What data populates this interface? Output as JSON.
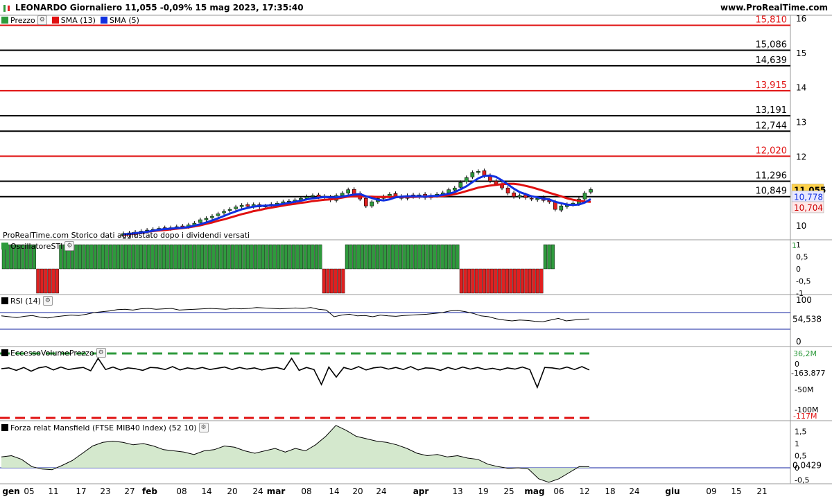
{
  "header": {
    "title": "LEONARDO Giornaliero 11,055 -0,09% 15 mag 2023, 17:35:40",
    "site": "www.ProRealTime.com"
  },
  "legend": {
    "price": "Prezzo",
    "sma13": "SMA (13)",
    "sma5": "SMA (5)"
  },
  "watermark": "ProRealTime.com  Storico dati aggiustato dopo i dividendi versati",
  "colors": {
    "up": "#2e9a3c",
    "down": "#e02020",
    "sma13": "#e01010",
    "sma5": "#1030e0",
    "hline_red": "#e01010",
    "hline_black": "#000000"
  },
  "chart_data": [
    {
      "type": "candlestick",
      "title": "LEONARDO Giornaliero",
      "ylim": [
        9.6,
        16.1
      ],
      "y_ticks": [
        "16",
        "15",
        "14",
        "13",
        "12",
        "10"
      ],
      "x_ticks": [
        "gen",
        "05",
        "11",
        "17",
        "23",
        "27",
        "feb",
        "08",
        "14",
        "20",
        "24",
        "mar",
        "08",
        "14",
        "20",
        "24",
        "apr",
        "13",
        "19",
        "25",
        "mag",
        "06",
        "12",
        "18",
        "24",
        "giu",
        "09",
        "15",
        "21"
      ],
      "horizontal_lines": [
        {
          "value": 15.81,
          "label": "15,810",
          "color": "red"
        },
        {
          "value": 15.086,
          "label": "15,086",
          "color": "black"
        },
        {
          "value": 14.639,
          "label": "14,639",
          "color": "black"
        },
        {
          "value": 13.915,
          "label": "13,915",
          "color": "red"
        },
        {
          "value": 13.191,
          "label": "13,191",
          "color": "black"
        },
        {
          "value": 12.744,
          "label": "12,744",
          "color": "black"
        },
        {
          "value": 12.02,
          "label": "12,020",
          "color": "red"
        },
        {
          "value": 11.296,
          "label": "11,296",
          "color": "black"
        },
        {
          "value": 10.849,
          "label": "10,849",
          "color": "black"
        }
      ],
      "price_tags": [
        {
          "label": "11,055",
          "value": 11.055,
          "bg": "#ffd24a"
        },
        {
          "label": "10,778",
          "value": 10.778,
          "bg": "#e8e8ff"
        },
        {
          "label": "10,704",
          "value": 10.704,
          "bg": "#ffe8e8"
        }
      ],
      "close": [
        9.78,
        9.74,
        9.82,
        9.85,
        9.88,
        9.9,
        9.93,
        9.92,
        9.95,
        9.98,
        9.97,
        10.03,
        10.08,
        10.18,
        10.22,
        10.28,
        10.35,
        10.42,
        10.48,
        10.55,
        10.6,
        10.57,
        10.62,
        10.55,
        10.58,
        10.63,
        10.66,
        10.7,
        10.72,
        10.75,
        10.8,
        10.85,
        10.88,
        10.84,
        10.82,
        10.75,
        10.88,
        10.95,
        11.05,
        10.92,
        10.78,
        10.58,
        10.7,
        10.8,
        10.85,
        10.92,
        10.86,
        10.8,
        10.88,
        10.85,
        10.9,
        10.82,
        10.88,
        10.92,
        10.96,
        11.05,
        11.1,
        11.26,
        11.4,
        11.55,
        11.58,
        11.45,
        11.3,
        11.22,
        11.1,
        10.95,
        10.85,
        10.88,
        10.82,
        10.78,
        10.8,
        10.74,
        10.7,
        10.48,
        10.58,
        10.62,
        10.66,
        10.78,
        10.95,
        11.055
      ],
      "open": [
        9.72,
        9.8,
        9.75,
        9.82,
        9.86,
        9.88,
        9.9,
        9.95,
        9.92,
        9.95,
        10.0,
        9.98,
        10.02,
        10.1,
        10.18,
        10.24,
        10.3,
        10.38,
        10.45,
        10.5,
        10.56,
        10.62,
        10.56,
        10.62,
        10.55,
        10.58,
        10.62,
        10.66,
        10.7,
        10.72,
        10.76,
        10.8,
        10.85,
        10.9,
        10.86,
        10.84,
        10.74,
        10.88,
        10.95,
        11.06,
        10.94,
        10.8,
        10.58,
        10.7,
        10.8,
        10.86,
        10.94,
        10.86,
        10.8,
        10.9,
        10.84,
        10.92,
        10.82,
        10.88,
        10.92,
        10.96,
        11.04,
        11.12,
        11.28,
        11.42,
        11.55,
        11.6,
        11.46,
        11.3,
        11.22,
        11.1,
        10.96,
        10.84,
        10.9,
        10.8,
        10.76,
        10.82,
        10.74,
        10.7,
        10.46,
        10.56,
        10.62,
        10.64,
        10.78,
        10.98
      ],
      "sma13": [
        9.74,
        9.76,
        9.78,
        9.8,
        9.83,
        9.85,
        9.87,
        9.88,
        9.9,
        9.92,
        9.94,
        9.96,
        9.99,
        10.02,
        10.06,
        10.1,
        10.15,
        10.19,
        10.24,
        10.29,
        10.34,
        10.38,
        10.43,
        10.46,
        10.5,
        10.53,
        10.56,
        10.59,
        10.62,
        10.64,
        10.67,
        10.69,
        10.72,
        10.74,
        10.76,
        10.77,
        10.79,
        10.82,
        10.85,
        10.86,
        10.86,
        10.85,
        10.85,
        10.84,
        10.84,
        10.84,
        10.84,
        10.84,
        10.84,
        10.84,
        10.85,
        10.85,
        10.85,
        10.86,
        10.87,
        10.89,
        10.92,
        10.96,
        11.01,
        11.06,
        11.11,
        11.14,
        11.17,
        11.19,
        11.21,
        11.22,
        11.22,
        11.2,
        11.16,
        11.12,
        11.07,
        11.02,
        10.96,
        10.91,
        10.86,
        10.8,
        10.76,
        10.73,
        10.71,
        10.7
      ],
      "sma5": [
        9.76,
        9.77,
        9.79,
        9.81,
        9.83,
        9.86,
        9.89,
        9.91,
        9.92,
        9.94,
        9.95,
        9.97,
        10.01,
        10.05,
        10.1,
        10.16,
        10.22,
        10.29,
        10.36,
        10.42,
        10.48,
        10.52,
        10.56,
        10.58,
        10.59,
        10.6,
        10.61,
        10.64,
        10.67,
        10.7,
        10.73,
        10.77,
        10.8,
        10.82,
        10.84,
        10.83,
        10.83,
        10.85,
        10.88,
        10.91,
        10.92,
        10.86,
        10.81,
        10.76,
        10.74,
        10.77,
        10.83,
        10.85,
        10.86,
        10.86,
        10.86,
        10.85,
        10.87,
        10.87,
        10.9,
        10.93,
        10.98,
        11.06,
        11.15,
        11.27,
        11.38,
        11.45,
        11.46,
        11.42,
        11.32,
        11.2,
        11.08,
        10.98,
        10.92,
        10.86,
        10.83,
        10.79,
        10.77,
        10.7,
        10.66,
        10.62,
        10.61,
        10.62,
        10.68,
        10.778
      ]
    },
    {
      "type": "bar",
      "title": "OscillatoreSTI",
      "ylim": [
        -1,
        1
      ],
      "y_ticks": [
        "1",
        "0,5",
        "0",
        "-0,5",
        "-1"
      ],
      "value_label": "1",
      "values": [
        1,
        1,
        1,
        1,
        1,
        1,
        1,
        1,
        1,
        -1,
        -1,
        -1,
        -1,
        -1,
        -1,
        1,
        1,
        1,
        1,
        1,
        1,
        1,
        1,
        1,
        1,
        1,
        1,
        1,
        1,
        1,
        1,
        1,
        1,
        1,
        1,
        1,
        1,
        1,
        1,
        1,
        1,
        1,
        1,
        1,
        1,
        1,
        1,
        1,
        1,
        1,
        1,
        1,
        1,
        1,
        1,
        1,
        1,
        1,
        1,
        1,
        1,
        1,
        1,
        1,
        1,
        1,
        1,
        1,
        1,
        1,
        1,
        1,
        1,
        1,
        1,
        1,
        1,
        1,
        1,
        1,
        1,
        1,
        1,
        1,
        -1,
        -1,
        -1,
        -1,
        -1,
        -1,
        1,
        1,
        1,
        1,
        1,
        1,
        1,
        1,
        1,
        1,
        1,
        1,
        1,
        1,
        1,
        1,
        1,
        1,
        1,
        1,
        1,
        1,
        1,
        1,
        1,
        1,
        1,
        1,
        1,
        1,
        -1,
        -1,
        -1,
        -1,
        -1,
        -1,
        -1,
        -1,
        -1,
        -1,
        -1,
        -1,
        -1,
        -1,
        -1,
        -1,
        -1,
        -1,
        -1,
        -1,
        -1,
        -1,
        1,
        1,
        1
      ]
    },
    {
      "type": "line",
      "title": "RSI (14)",
      "ylim": [
        0,
        100
      ],
      "y_ticks": [
        "100",
        "0"
      ],
      "levels": [
        70,
        30
      ],
      "value_label": "54,538",
      "values": [
        62,
        60,
        58,
        61,
        63,
        59,
        57,
        60,
        62,
        64,
        63,
        66,
        70,
        72,
        74,
        77,
        78,
        76,
        79,
        80,
        78,
        79,
        80,
        76,
        77,
        78,
        79,
        80,
        79,
        78,
        80,
        79,
        80,
        82,
        81,
        80,
        79,
        80,
        81,
        80,
        82,
        78,
        76,
        60,
        64,
        66,
        62,
        63,
        60,
        64,
        62,
        61,
        63,
        64,
        65,
        66,
        68,
        70,
        74,
        75,
        72,
        68,
        62,
        60,
        55,
        52,
        50,
        52,
        51,
        49,
        48,
        52,
        56,
        50,
        52,
        54,
        54.538
      ]
    },
    {
      "type": "line",
      "title": "EccessoVolumePrezzo",
      "ylim": [
        -117,
        40
      ],
      "y_ticks": [
        "0",
        "-50M",
        "-100M"
      ],
      "levels": [
        36.2,
        -117
      ],
      "value_labels": [
        "36,2M",
        "-163.877",
        "-117M"
      ],
      "values": [
        0,
        2,
        -4,
        3,
        -6,
        2,
        5,
        -3,
        4,
        -2,
        1,
        3,
        -5,
        25,
        -2,
        4,
        -3,
        2,
        0,
        -4,
        3,
        2,
        -2,
        5,
        -3,
        2,
        -1,
        3,
        -2,
        1,
        4,
        -2,
        3,
        -1,
        2,
        -3,
        1,
        3,
        -2,
        25,
        -4,
        3,
        -2,
        -38,
        4,
        -20,
        3,
        -2,
        5,
        -3,
        2,
        4,
        -1,
        3,
        -2,
        5,
        -3,
        2,
        1,
        -4,
        3,
        -2,
        4,
        -1,
        3,
        -2,
        1,
        -3,
        2,
        -1,
        4,
        -2,
        -45,
        3,
        2,
        -1,
        4,
        -2,
        5,
        -3
      ]
    },
    {
      "type": "area",
      "title": "Forza relat Mansfield (FTSE MIB40 Index) (52 10)",
      "ylim": [
        -0.75,
        1.75
      ],
      "y_ticks": [
        "1,5",
        "1",
        "0,5",
        "0",
        "-0,5"
      ],
      "value_label": "0,0429",
      "values": [
        0.45,
        0.5,
        0.35,
        0.05,
        -0.05,
        -0.08,
        0.1,
        0.3,
        0.6,
        0.9,
        1.05,
        1.1,
        1.05,
        0.95,
        1.0,
        0.9,
        0.75,
        0.7,
        0.65,
        0.55,
        0.7,
        0.75,
        0.9,
        0.85,
        0.7,
        0.6,
        0.7,
        0.8,
        0.65,
        0.8,
        0.7,
        0.95,
        1.3,
        1.75,
        1.55,
        1.3,
        1.2,
        1.1,
        1.05,
        0.95,
        0.8,
        0.6,
        0.5,
        0.55,
        0.45,
        0.5,
        0.4,
        0.35,
        0.15,
        0.05,
        -0.02,
        0.0,
        -0.05,
        -0.45,
        -0.6,
        -0.45,
        -0.2,
        0.05,
        0.0429
      ]
    }
  ]
}
